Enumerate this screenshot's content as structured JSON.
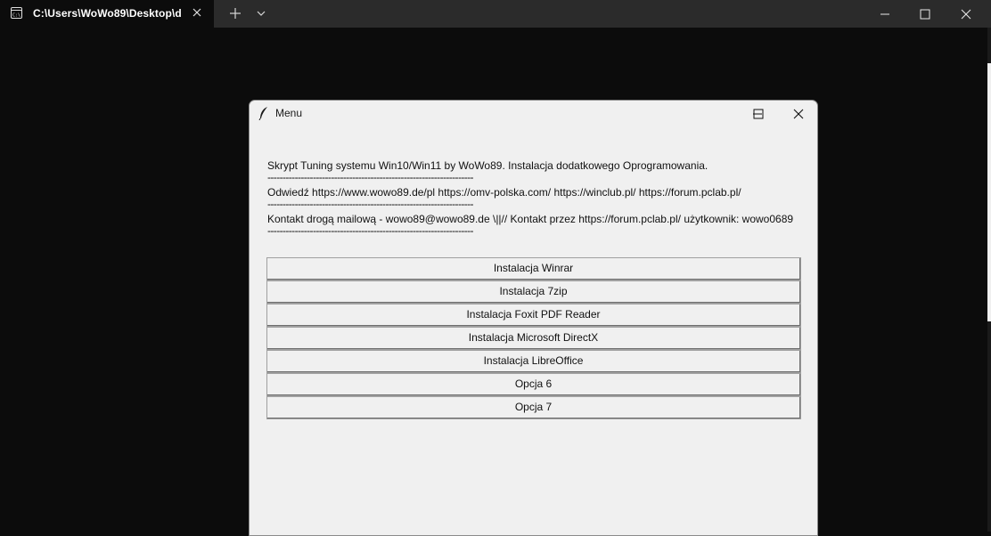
{
  "terminal": {
    "tab_title": "C:\\Users\\WoWo89\\Desktop\\d",
    "tab_icon": "terminal-icon",
    "new_tab_icon": "plus-icon",
    "dropdown_icon": "chevron-down-icon",
    "controls": [
      "minimize-icon",
      "maximize-icon",
      "close-icon"
    ]
  },
  "menu_window": {
    "title": "Menu",
    "icon": "feather-icon",
    "lines": [
      "Skrypt Tuning systemu Win10/Win11 by WoWo89. Instalacja dodatkowego Oprogramowania.",
      "--------------------------------------------------------------------",
      "Odwiedź https://www.wowo89.de/pl  https://omv-polska.com/  https://winclub.pl/  https://forum.pclab.pl/",
      "--------------------------------------------------------------------",
      "Kontakt drogą mailową - wowo89@wowo89.de \\||// Kontakt przez https://forum.pclab.pl/ użytkownik: wowo0689",
      "--------------------------------------------------------------------"
    ],
    "buttons": [
      "Instalacja Winrar",
      "Instalacja 7zip",
      "Instalacja Foxit PDF Reader",
      "Instalacja Microsoft DirectX",
      "Instalacja LibreOffice",
      "Opcja 6",
      "Opcja 7"
    ]
  },
  "colors": {
    "terminal_bg": "#0c0c0c",
    "window_bg": "#f0f0f0"
  }
}
